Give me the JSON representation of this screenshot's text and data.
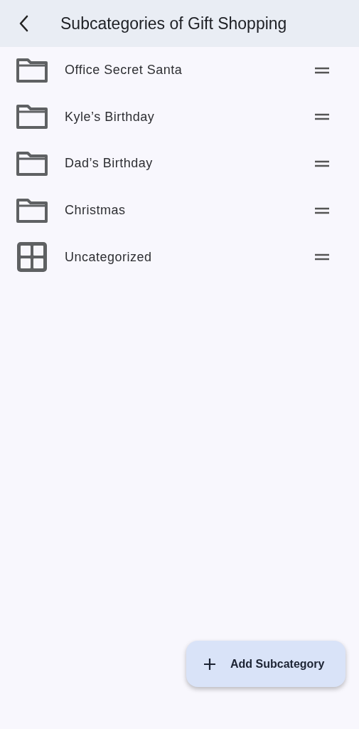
{
  "header": {
    "title": "Subcategories of Gift Shopping"
  },
  "items": [
    {
      "kind": "folder",
      "label": "Office Secret Santa"
    },
    {
      "kind": "folder",
      "label": "Kyle’s Birthday"
    },
    {
      "kind": "folder",
      "label": "Dad’s Birthday"
    },
    {
      "kind": "folder",
      "label": "Christmas"
    },
    {
      "kind": "grid",
      "label": "Uncategorized"
    }
  ],
  "fab": {
    "label": "Add Subcategory"
  }
}
